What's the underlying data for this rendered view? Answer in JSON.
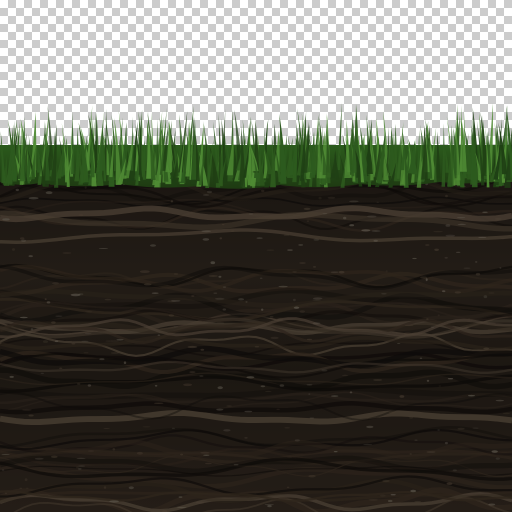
{
  "texture": {
    "regions": [
      {
        "name": "transparent-background",
        "pattern": "checkerboard"
      },
      {
        "name": "grass-top",
        "color": "#2d5a1e"
      },
      {
        "name": "soil-strata",
        "color": "#1d1813"
      }
    ],
    "colors": {
      "checker_light": "#ffffff",
      "checker_dark": "#cccccc",
      "grass_dark": "#1f3f14",
      "grass_mid": "#2d5a1e",
      "grass_light": "#4f8a34",
      "soil_base": "#1d1813",
      "soil_dark": "#0e0b09",
      "soil_mid": "#2e251c",
      "soil_light": "#4a3f33",
      "soil_speck": "#6a655a"
    }
  }
}
